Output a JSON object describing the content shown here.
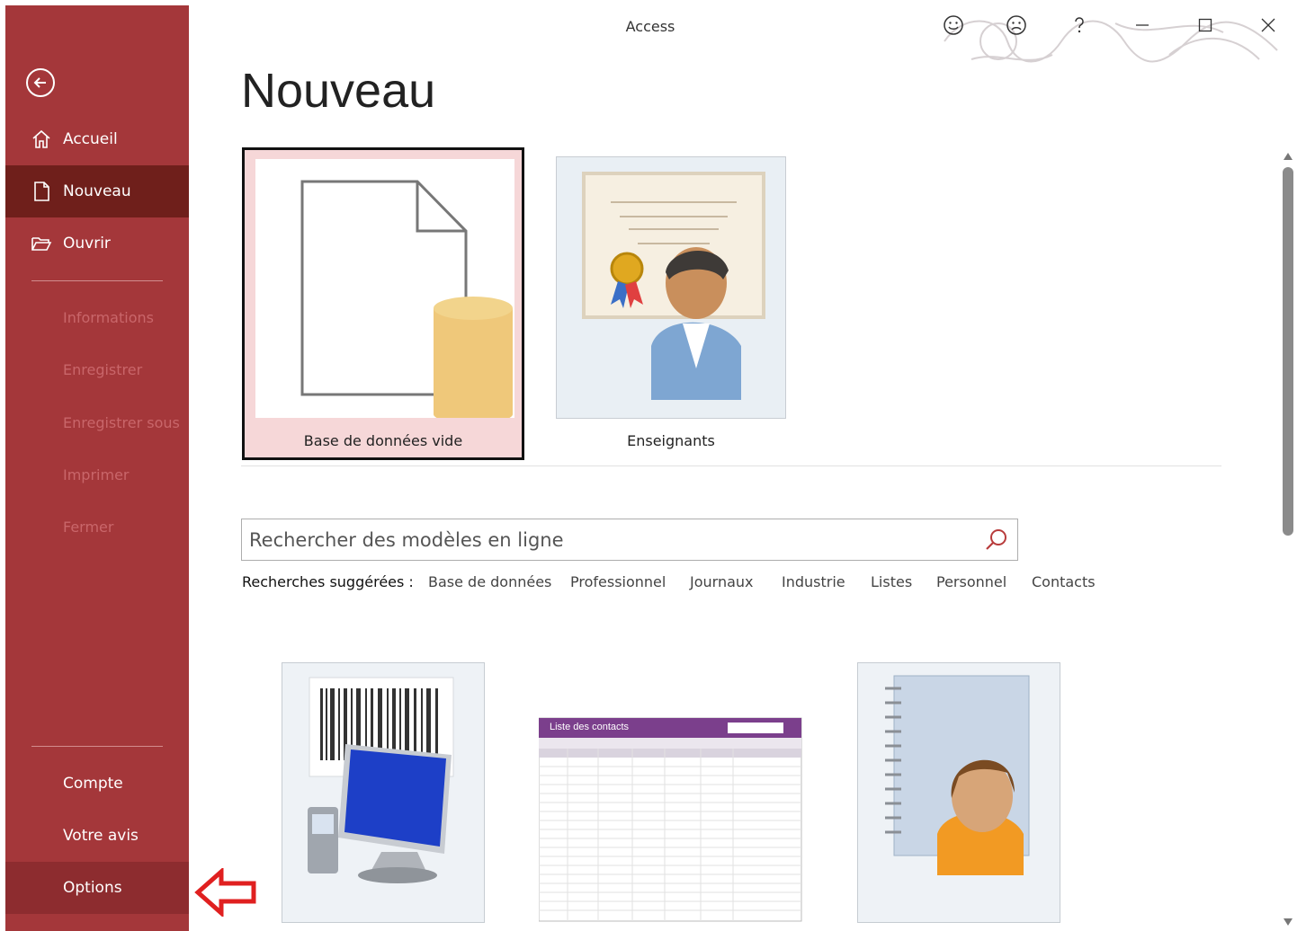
{
  "window": {
    "title": "Access"
  },
  "sidebar": {
    "items": [
      {
        "label": "Accueil",
        "icon": "home-icon"
      },
      {
        "label": "Nouveau",
        "icon": "new-document-icon"
      },
      {
        "label": "Ouvrir",
        "icon": "open-folder-icon"
      }
    ],
    "disabled_items": [
      "Informations",
      "Enregistrer",
      "Enregistrer sous",
      "Imprimer",
      "Fermer"
    ],
    "bottom_items": [
      "Compte",
      "Votre avis",
      "Options"
    ]
  },
  "header": {
    "page_title": "Nouveau"
  },
  "templates": {
    "featured": [
      {
        "label": "Base de données vide"
      },
      {
        "label": "Enseignants"
      }
    ]
  },
  "search": {
    "placeholder": "Rechercher des modèles en ligne"
  },
  "suggested": {
    "heading": "Recherches suggérées :",
    "terms": [
      "Base de données",
      "Professionnel",
      "Journaux",
      "Industrie",
      "Listes",
      "Personnel",
      "Contacts"
    ]
  },
  "contacts_preview": {
    "title": "Liste des contacts"
  },
  "colors": {
    "sidebar": "#a4373a",
    "sidebar_active": "#6f1f1b",
    "accent_red": "#e02020"
  }
}
